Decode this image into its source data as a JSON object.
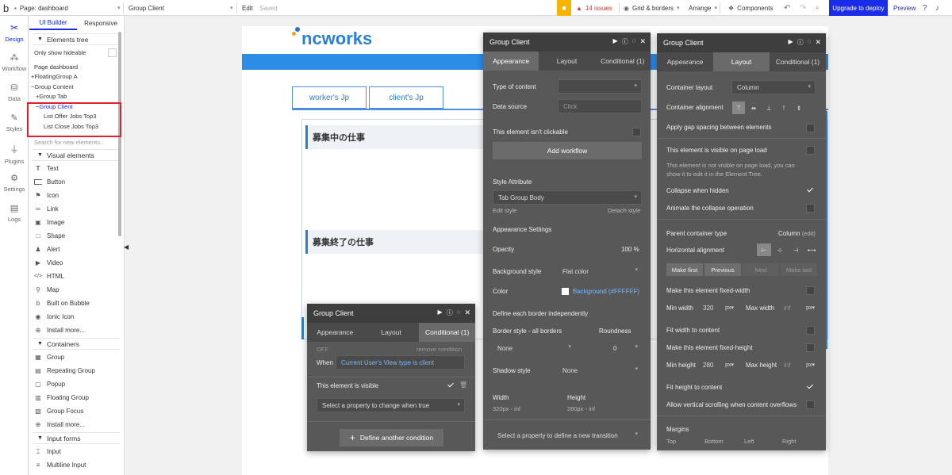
{
  "topbar": {
    "logo_letter": "b",
    "page_label": "Page: dashboard",
    "element_select": "Group Client",
    "edit": "Edit",
    "saved": "Saved",
    "issues": "14 issues",
    "grid_borders": "Grid & borders",
    "arrange": "Arrange",
    "components": "Components",
    "upgrade": "Upgrade to deploy",
    "preview": "Preview"
  },
  "rail": {
    "items": [
      {
        "label": "Design",
        "icon": "design-icon"
      },
      {
        "label": "Workflow",
        "icon": "workflow-icon"
      },
      {
        "label": "Data",
        "icon": "data-icon"
      },
      {
        "label": "Styles",
        "icon": "styles-icon"
      },
      {
        "label": "Plugins",
        "icon": "plugins-icon"
      },
      {
        "label": "Settings",
        "icon": "settings-icon"
      },
      {
        "label": "Logs",
        "icon": "logs-icon"
      }
    ]
  },
  "leftpanel": {
    "tabs": [
      "UI Builder",
      "Responsive"
    ],
    "elements_tree": "Elements tree",
    "only_hideable": "Only show hideable",
    "tree": [
      "Page dashboard",
      "FloatingGroup A",
      "Group Content",
      "Group Tab",
      "Group Client",
      "List Offer Jobs Top3",
      "List Close Jobs Top3"
    ],
    "search_placeholder": "Search for new elements...",
    "visual_header": "Visual elements",
    "visual": [
      "Text",
      "Button",
      "Icon",
      "Link",
      "Image",
      "Shape",
      "Alert",
      "Video",
      "HTML",
      "Map",
      "Built on Bubble",
      "Ionic Icon",
      "Install more..."
    ],
    "containers_header": "Containers",
    "containers": [
      "Group",
      "Repeating Group",
      "Popup",
      "Floating Group",
      "Group Focus",
      "Install more..."
    ],
    "inputs_header": "Input forms",
    "inputs": [
      "Input",
      "Multiline Input"
    ]
  },
  "canvas": {
    "logo": "ncworks",
    "tab1": "worker's Jp",
    "tab2": "client's Jp",
    "heading1": "募集中の仕事",
    "heading2": "募集終了の仕事"
  },
  "panel_appearance": {
    "title": "Group Client",
    "tabs": [
      "Appearance",
      "Layout",
      "Conditional (1)"
    ],
    "type_of_content": "Type of content",
    "data_source": "Data source",
    "data_source_placeholder": "Click",
    "not_clickable": "This element isn't clickable",
    "add_workflow": "Add workflow",
    "style_attribute": "Style Attribute",
    "style_value": "Tab Group Body",
    "edit_style": "Edit style",
    "detach_style": "Detach style",
    "appearance_settings": "Appearance Settings",
    "opacity": "Opacity",
    "opacity_value": "100",
    "opacity_unit": "%",
    "background_style": "Background style",
    "background_value": "Flat color",
    "color": "Color",
    "color_value": "Background (#FFFFFF)",
    "define_border": "Define each border independently",
    "border_style": "Border style - all borders",
    "roundness": "Roundness",
    "border_value": "None",
    "roundness_value": "0",
    "shadow_style": "Shadow style",
    "shadow_value": "None",
    "width": "Width",
    "height": "Height",
    "width_value": "320px - inf",
    "height_value": "280px - inf",
    "transition_placeholder": "Select a property to define a new transition"
  },
  "panel_layout": {
    "title": "Group Client",
    "tabs": [
      "Appearance",
      "Layout",
      "Conditional (1)"
    ],
    "container_layout": "Container layout",
    "container_layout_value": "Column",
    "container_alignment": "Container alignment",
    "gap_spacing": "Apply gap spacing between elements",
    "visible_on_load": "This element is visible on page load",
    "visible_note": "This element is not visible on page load, you can show it to edit it in the Element Tree.",
    "collapse_hidden": "Collapse when hidden",
    "animate_collapse": "Animate the collapse operation",
    "parent_container_type": "Parent container type",
    "parent_value": "Column",
    "parent_edit": "(edit)",
    "horizontal_alignment": "Horizontal alignment",
    "nav": [
      "Make first",
      "Previous",
      "Next",
      "Make last"
    ],
    "fixed_width": "Make this element fixed-width",
    "min_width": "Min width",
    "min_width_value": "320",
    "max_width": "Max width",
    "inf": "inf",
    "unit": "px",
    "fit_width": "Fit width to content",
    "fixed_height": "Make this element fixed-height",
    "min_height": "Min height",
    "min_height_value": "280",
    "max_height": "Max height",
    "fit_height": "Fit height to content",
    "vertical_scroll": "Allow vertical scrolling when content overflows",
    "margins": "Margins",
    "margin_labels": [
      "Top",
      "Bottom",
      "Left",
      "Right"
    ]
  },
  "panel_conditional": {
    "title": "Group Client",
    "tabs": [
      "Appearance",
      "Layout",
      "Conditional (1)"
    ],
    "off": "OFF",
    "remove_condition": "remove condition",
    "when": "When",
    "when_value": "Current User's View type is client",
    "visible": "This element is visible",
    "select_property": "Select a property to change when true",
    "define_another": "Define another condition"
  }
}
